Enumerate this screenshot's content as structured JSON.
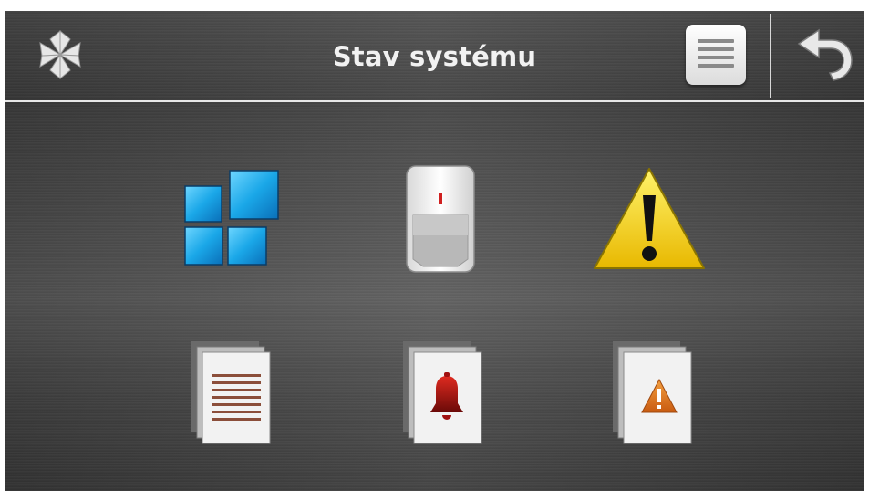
{
  "header": {
    "title": "Stav systému",
    "logo_icon": "satel-logo-icon",
    "menu_icon": "menu-list-icon",
    "back_icon": "back-arrow-icon"
  },
  "tiles": [
    {
      "name": "partitions-tile",
      "icon": "partitions-icon"
    },
    {
      "name": "zones-tile",
      "icon": "motion-detector-icon"
    },
    {
      "name": "troubles-tile",
      "icon": "warning-triangle-icon"
    },
    {
      "name": "event-log-tile",
      "icon": "event-log-icon"
    },
    {
      "name": "alarm-memory-tile",
      "icon": "alarm-bell-log-icon"
    },
    {
      "name": "trouble-memory-tile",
      "icon": "trouble-log-icon"
    }
  ],
  "colors": {
    "accent_blue": "#1aa7e8",
    "warning_yellow": "#f2d21a",
    "alarm_red": "#c0201a",
    "trouble_orange": "#e07a1a"
  }
}
